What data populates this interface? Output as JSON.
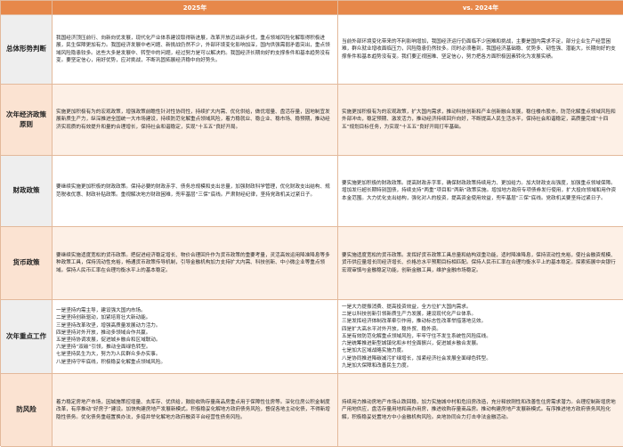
{
  "header": {
    "corner": "",
    "col_2025": "2025年",
    "col_2024": "vs. 2024年"
  },
  "rows": [
    {
      "label": "总体形势判断",
      "y2025": "我国经济顶压前行、向新向优发展，现代化产业体系建设取得新进展，改革开放迈出新步伐，重点领域风险化解取得积极进展，民生保障更加有力。我国经济发展中老问题、新挑战仍然不少，外部环境变化影响加深，国内供强需弱矛盾突出，重点领域风险隐患较多。这些大多是发展中、转型中的问题，经过努力是可以解决的。我国经济长期向好的支撑条件和基本趋势没有变。要坚定信心，用好优势，应对挑战，不断巩固拓展经济稳中向好势头。",
      "y2024": "当前外部环境变化带来的不利影响增加，我国经济运行仍面临不少困难和挑战，主要是国内需求不足，部分企业生产经营困难，群众就业增收面临压力，风险隐患仍然较多。同时必须看到，我国经济基础稳、优势多、韧性强、潜能大，长期向好的支撑条件和基本趋势没有变。我们要正视困难、坚定信心，努力把各方面积极因素转化为发展实绩。"
    },
    {
      "label": "次年经济政策原则",
      "y2025": "实施更加积极有为的宏观政策，增强政策前瞻性针对性协同性，持续扩大内需、优化供给，做优增量、盘活存量，因地制宜发展新质生产力，纵深推进全国统一大市场建设，持续防范化解重点领域风险，着力稳就业、稳企业、稳市场、稳预期，推动经济实现质的有效提升和量的合理增长，保持社会和谐稳定，实现“十五五”良好开局。",
      "y2024": "实施更加积极有为的宏观政策，扩大国内需求，推动科技创新和产业创新融合发展，稳住楼市股市，防范化解重点领域风险和外部冲击，稳定预期、激发活力，推动经济持续回升向好，不断提高人民生活水平，保持社会和谐稳定，高质量完成“十四五”规划目标任务，为实现“十五五”良好开局打牢基础。"
    },
    {
      "label": "财政政策",
      "y2025": "要继续实施更加积极的财政政策。保持必要的财政赤字、债务总规模和支出总量，加强财政科学管理，优化财政支出结构、规范税收优惠、财政补贴政策。重视解决地方财政困难，兜牢基层“三保”底线。严肃财经纪律，坚持党政机关过紧日子。",
      "y2024": "要实施更加积极的财政政策。提高财政赤字率，确保财政政策持续用力、更加给力。加大财政支出强度，加强重点领域保障。增加发行超长期特别国债，持续支持“两重”项目和“两新”政策实施。增加地方政府专项债券发行使用，扩大投向领域和用作资本金范围。大力优化支出结构，强化对人的投资，提高资金使用效益，兜牢基层“三保”底线。党政机关要坚持过紧日子。"
    },
    {
      "label": "货币政策",
      "y2025": "要继续实施适度宽松的货币政策。把促进经济稳定增长、物价合理回升作为货币政策的重要考量，灵活高效运用降准降息等多种政策工具，保持流动性充裕，畅通货币政策传导机制，引导金融机构加力支持扩大内需、科技创新、中小微企业等重点领域。保持人民币汇率在合理均衡水平上的基本稳定。",
      "y2024": "要实施适度宽松的货币政策。发挥好货币政策工具总量和结构双重功能，适时降准降息，保持流动性充裕，使社会融资规模、货币供应量增长同经济增长、价格总水平预期目标相匹配。保持人民币汇率在合理均衡水平上的基本稳定。探索拓展中央银行宏观审慎与金融稳定功能，创新金融工具，维护金融市场稳定。"
    },
    {
      "label": "次年重点工作",
      "y2025": "一是坚持内需主导，建设强大国内市场。\n二是坚持创新驱动，加紧培育壮大新动能。\n三是坚持改革攻坚，增强高质量发展动力活力。\n四是坚持对外开放，推动多领域合作共赢。\n五是坚持协调发展，促进城乡融合和区域联动。\n六是坚持“双碳”引领，推动全面绿色转型。\n七是坚持民生为大，努力为人民群众多办实事。\n八是坚持守牢底线，积极稳妥化解重点领域风险。",
      "y2024": "一是大力提振消费、提高投资效益，全方位扩大国内需求。\n二是以科技创新引领新质生产力发展，建设现代化产业体系。\n三是发挥经济体制改革牵引作用，推动标志性改革举措落地见效。\n四是扩大高水平对外开放，稳外贸、稳外资。\n五是有效防范化解重点领域风险，牢牢守住不发生系统性风险底线。\n六是统筹推进新型城镇化和乡村全面振兴，促进城乡融合发展。\n七是加大区域战略实施力度。\n八是协同推进降碳减污扩绿增长，加紧经济社会发展全面绿色转型。\n九是加大保障和改善民生力度。"
    },
    {
      "label": "防风险",
      "y2025": "着力稳定房地产市场，因城施策控增量、去库存、优供给，鼓励收购存量商品房重点用于保障性住房等。深化住房公积金制度改革，有序推动“好房子”建设。加快构建房地产发展新模式。积极稳妥化解地方政府债务风险，督促各地主动化债，不得新增隐性债务。优化债务重组置换办法，多措并举化解地方政府融资平台经营性债务风险。",
      "y2024": "持续用力推动房地产市场止跌回稳，加力实施城中村和危旧房改造，充分释放刚性和改善性住房需求潜力。合理控制新增房地产用地供应，盘活存量用地和商办用房，推进收购存量商品房。推动构建房地产发展新模式。有序推进地方政府债务风险化解，积极稳妥处置地方中小金融机构风险。央地协同合力打击非法金融活动。"
    }
  ]
}
